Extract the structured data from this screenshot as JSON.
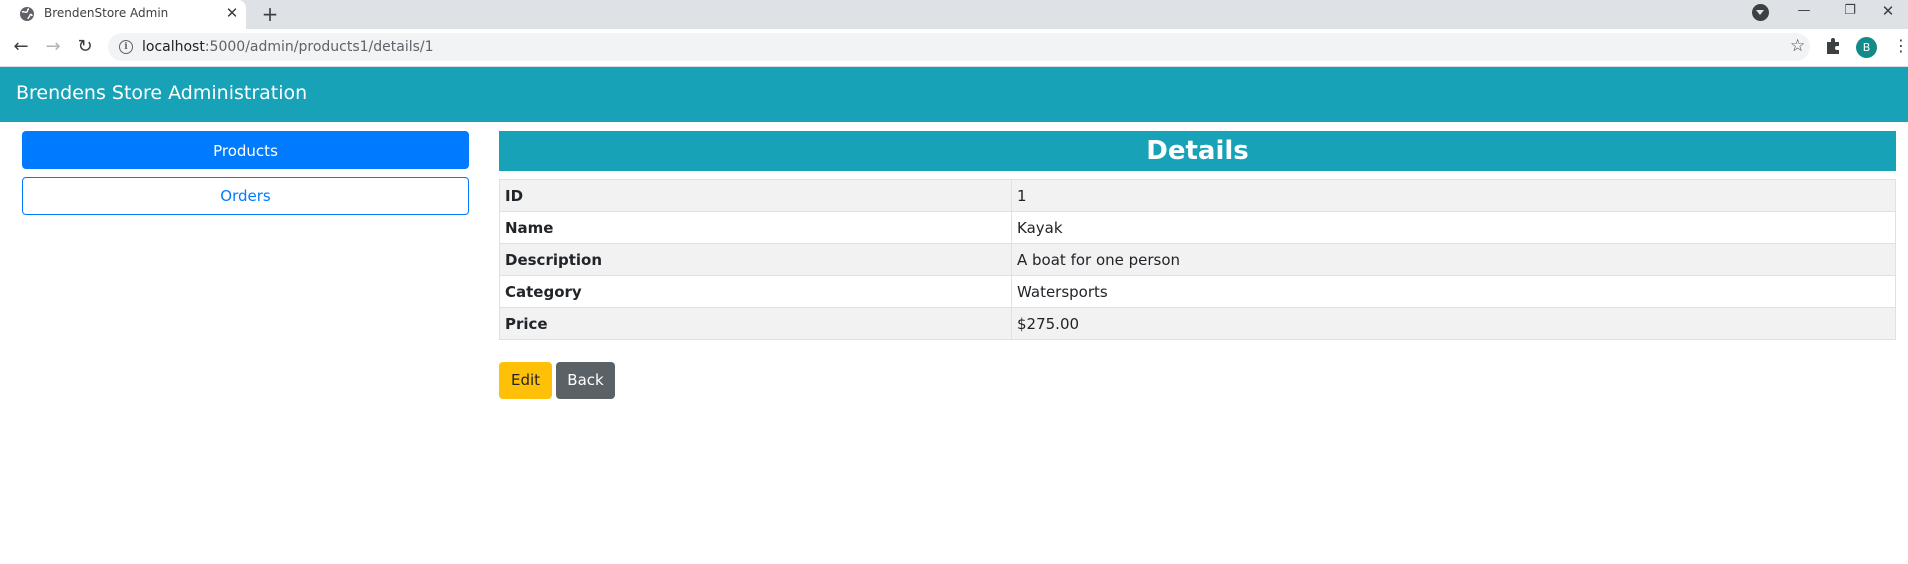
{
  "browser": {
    "tab_title": "BrendenStore Admin",
    "tab_close": "✕",
    "new_tab": "+",
    "url_host": "localhost",
    "url_path": ":5000/admin/products1/details/1",
    "profile_initial": "B",
    "icons": [
      "globe-icon",
      "close-icon",
      "plus-icon",
      "tab-search-icon",
      "back-arrow-icon",
      "forward-arrow-icon",
      "reload-icon",
      "info-icon",
      "star-icon",
      "extensions-puzzle-icon",
      "menu-kebab-icon"
    ]
  },
  "navbar": {
    "brand": "Brendens Store Administration",
    "color": "#17a2b8"
  },
  "sidebar": {
    "items": [
      {
        "label": "Products",
        "active": true
      },
      {
        "label": "Orders",
        "active": false
      }
    ]
  },
  "details": {
    "heading": "Details",
    "rows": [
      {
        "label": "ID",
        "value": "1"
      },
      {
        "label": "Name",
        "value": "Kayak"
      },
      {
        "label": "Description",
        "value": "A boat for one person"
      },
      {
        "label": "Category",
        "value": "Watersports"
      },
      {
        "label": "Price",
        "value": "$275.00"
      }
    ]
  },
  "actions": {
    "edit_label": "Edit",
    "back_label": "Back"
  },
  "colors": {
    "primary": "#007bff",
    "warning": "#ffc107",
    "secondary": "#5a6268",
    "info": "#17a2b8"
  }
}
